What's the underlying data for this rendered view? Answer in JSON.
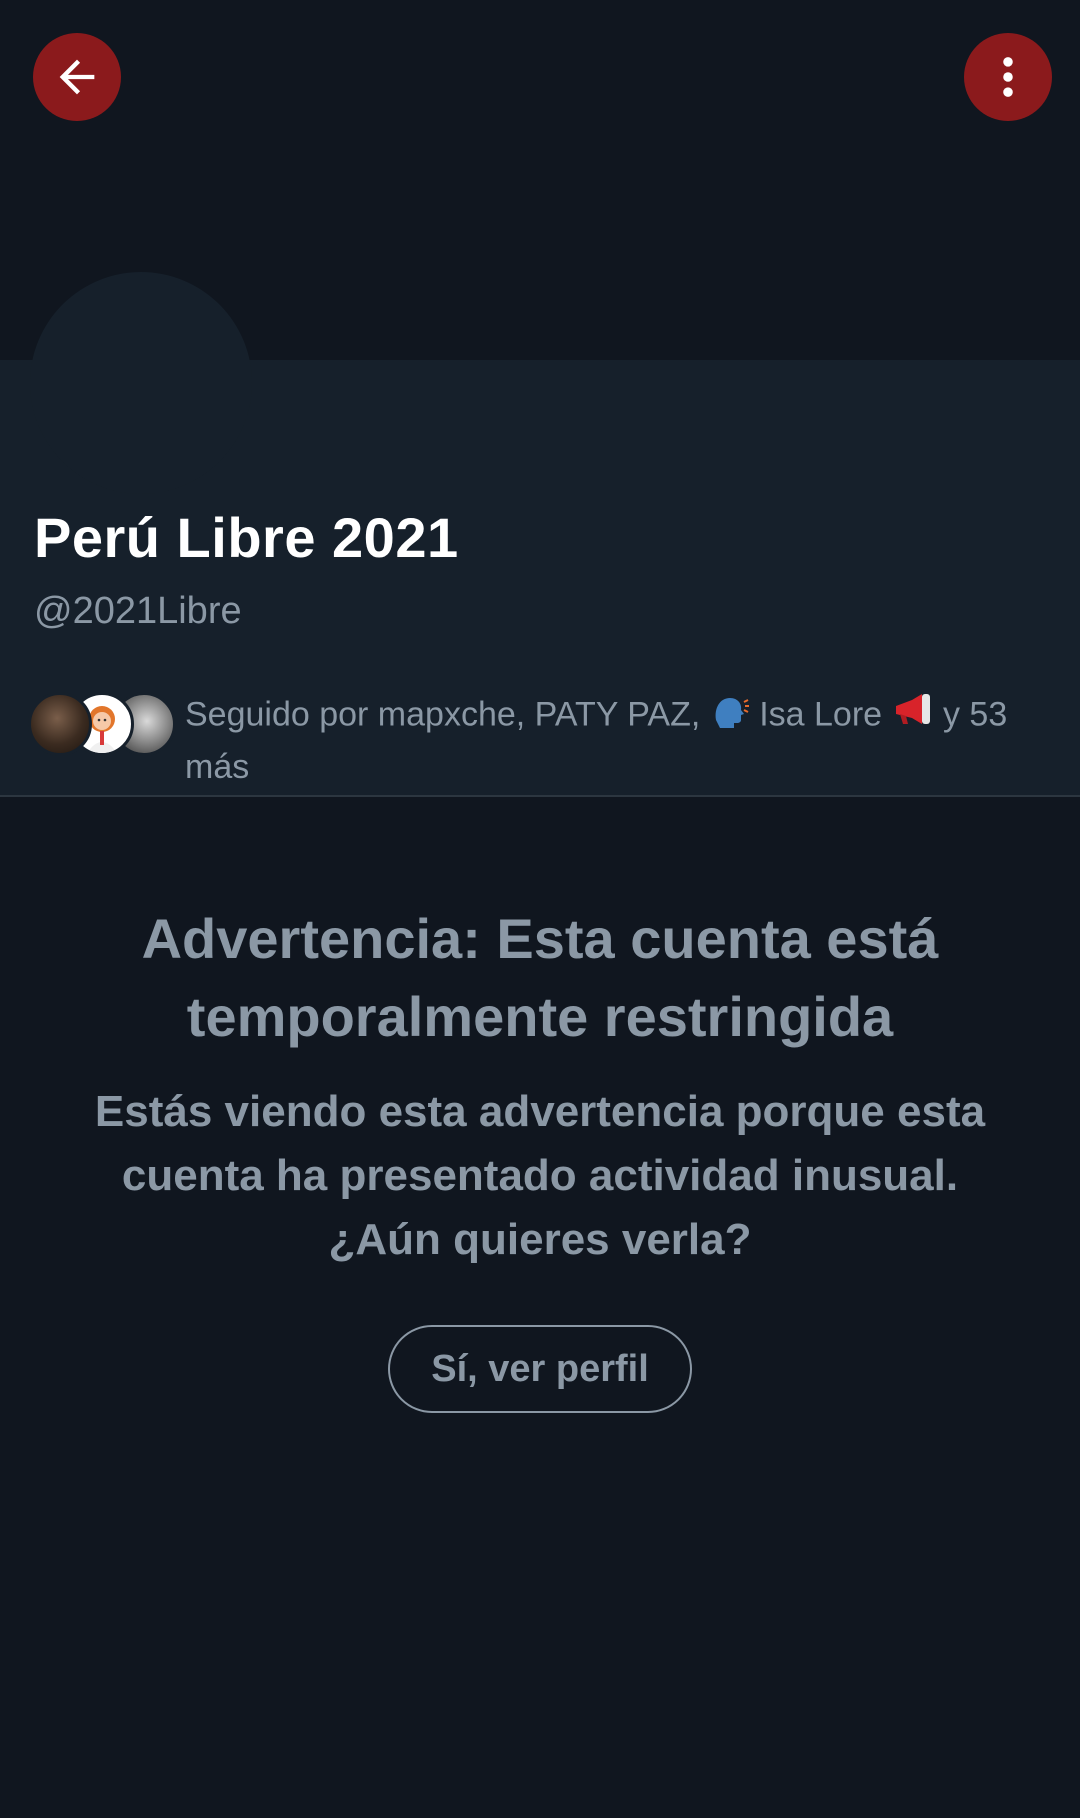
{
  "header": {
    "back_icon": "arrow-left-icon",
    "more_icon": "vertical-dots-icon",
    "accent_color": "#8b1a1c"
  },
  "profile": {
    "display_name": "Perú Libre 2021",
    "handle": "@2021Libre",
    "followers": {
      "prefix": "Seguido por mapxche, PATY PAZ,",
      "emoji1": "🗣",
      "name3": "Isa Lore",
      "emoji2": "📢",
      "suffix": "y 53 más"
    }
  },
  "warning": {
    "title": "Advertencia: Esta cuenta está temporalmente restringida",
    "body": "Estás viendo esta advertencia porque esta cuenta ha presentado actividad inusual. ¿Aún quieres verla?",
    "button_label": "Sí, ver perfil"
  },
  "colors": {
    "background": "#10161f",
    "card": "#16202b",
    "secondary_text": "#8b98a5"
  }
}
